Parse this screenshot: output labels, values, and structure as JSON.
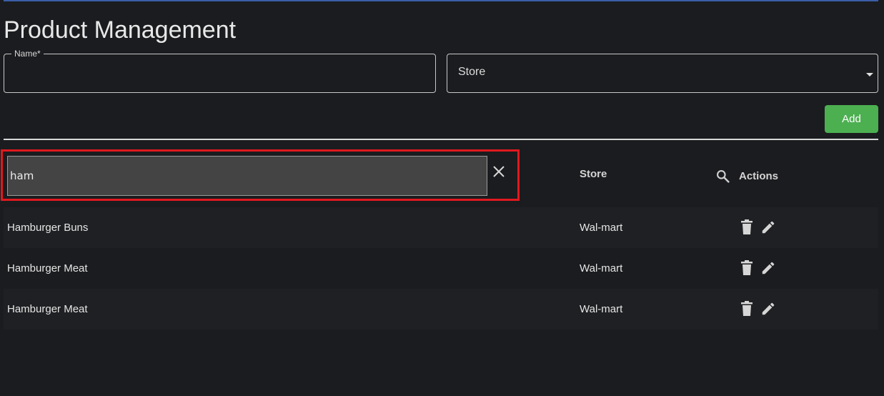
{
  "page": {
    "title": "Product Management"
  },
  "form": {
    "name_label": "Name*",
    "name_value": "",
    "store_label": "Store",
    "add_label": "Add"
  },
  "table": {
    "search_value": "ham",
    "columns": {
      "store": "Store",
      "actions": "Actions"
    },
    "rows": [
      {
        "name": "Hamburger Buns",
        "store": "Wal-mart"
      },
      {
        "name": "Hamburger Meat",
        "store": "Wal-mart"
      },
      {
        "name": "Hamburger Meat",
        "store": "Wal-mart"
      }
    ]
  },
  "icons": {
    "clear": "close-icon",
    "search": "search-icon",
    "delete": "trash-icon",
    "edit": "pencil-icon",
    "dropdown": "caret-down-icon"
  },
  "colors": {
    "background": "#1b1c1f",
    "add_button": "#4caf50",
    "highlight": "#e0191e",
    "search_box": "#444444"
  }
}
